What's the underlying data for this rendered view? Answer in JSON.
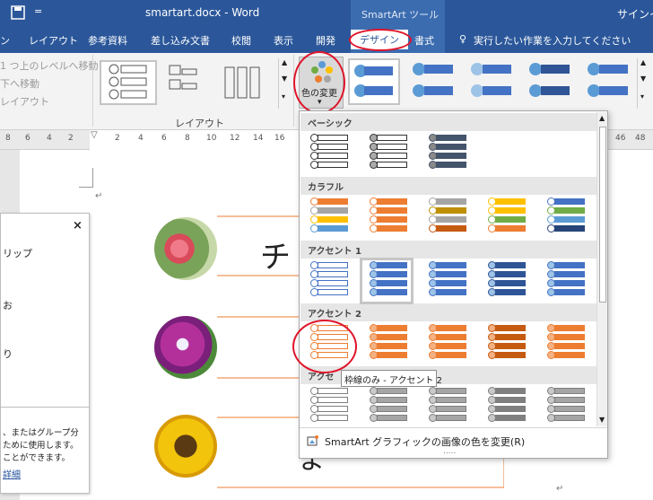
{
  "title_bar": {
    "quick_access_icon": "save-icon",
    "document_title": "smartart.docx  -  Word",
    "context_group": "SmartArt ツール",
    "sign_in": "サインイン"
  },
  "tabs": {
    "items": [
      "ン",
      "レイアウト",
      "参考資料",
      "差し込み文書",
      "校閲",
      "表示",
      "開発"
    ],
    "active": "デザイン",
    "format": "書式",
    "tell_me": "実行したい作業を入力してください"
  },
  "ribbon": {
    "promote": "1 つ上のレベルへ移動",
    "move_down": "下へ移動",
    "layout_btn": "レイアウト",
    "layouts_group_label": "レイアウト",
    "change_colors": "色の変更",
    "change_colors_caret": "▾"
  },
  "ruler": {
    "left_ticks": [
      "8",
      "6",
      "4",
      "2"
    ],
    "right_ticks": [
      "2",
      "4",
      "6",
      "8",
      "10",
      "12",
      "14",
      "16"
    ],
    "far_ticks": [
      "46",
      "48"
    ]
  },
  "pane": {
    "close": "×",
    "items": [
      "リップ",
      "お",
      "り"
    ],
    "desc_lines": [
      "、またはグループ分",
      "ために使用します。",
      "ことができます。"
    ],
    "more": "詳細"
  },
  "document": {
    "chip_text": "チ",
    "bottom_text": "ま",
    "return_mark": "↵"
  },
  "gallery": {
    "sections": [
      {
        "title": "ベーシック",
        "swatches": [
          {
            "dot": "#ffffff",
            "bar": "#ffffff",
            "outline": "#333333"
          },
          {
            "dot": "#aaaaaa",
            "bar": "#ffffff",
            "outline": "#333333"
          },
          {
            "dot": "#8a8a8a",
            "bar": "#44546a",
            "outline": "#44546a"
          }
        ]
      },
      {
        "title": "カラフル",
        "swatches": [
          {
            "colors": [
              "#ed7d31",
              "#a5a5a5",
              "#ffc000",
              "#5b9bd5"
            ]
          },
          {
            "colors": [
              "#ed7d31",
              "#ed7d31",
              "#ed7d31",
              "#ed7d31"
            ]
          },
          {
            "colors": [
              "#a5a5a5",
              "#bf9000",
              "#a5a5a5",
              "#c55a11"
            ]
          },
          {
            "colors": [
              "#ffc000",
              "#ffc000",
              "#70ad47",
              "#ed7d31"
            ]
          },
          {
            "colors": [
              "#4472c4",
              "#70ad47",
              "#5b9bd5",
              "#264478"
            ]
          }
        ]
      },
      {
        "title": "アクセント 1",
        "swatches": [
          {
            "dot": "#ffffff",
            "bar": "#ffffff",
            "outline": "#4472c4"
          },
          {
            "dot": "#9dc3e6",
            "bar": "#4472c4",
            "outline": "#4472c4"
          },
          {
            "dot": "#9dc3e6",
            "bar": "#4472c4",
            "outline": "#4472c4"
          },
          {
            "dot": "#9dc3e6",
            "bar": "#2f5597",
            "outline": "#2f5597"
          },
          {
            "dot": "#9dc3e6",
            "bar": "#4472c4",
            "outline": "#4472c4"
          }
        ]
      },
      {
        "title": "アクセント 2",
        "swatches": [
          {
            "dot": "#ffffff",
            "bar": "#ffffff",
            "outline": "#ed7d31"
          },
          {
            "dot": "#f4b183",
            "bar": "#ed7d31",
            "outline": "#ed7d31"
          },
          {
            "dot": "#f4b183",
            "bar": "#ed7d31",
            "outline": "#ed7d31"
          },
          {
            "dot": "#f4b183",
            "bar": "#c55a11",
            "outline": "#c55a11"
          },
          {
            "dot": "#f4b183",
            "bar": "#ed7d31",
            "outline": "#ed7d31"
          }
        ]
      },
      {
        "title": "アクセ",
        "swatches": [
          {
            "dot": "#ffffff",
            "bar": "#ffffff",
            "outline": "#7f7f7f"
          },
          {
            "dot": "#c9c9c9",
            "bar": "#a5a5a5",
            "outline": "#7f7f7f"
          },
          {
            "dot": "#c9c9c9",
            "bar": "#a5a5a5",
            "outline": "#7f7f7f"
          },
          {
            "dot": "#c9c9c9",
            "bar": "#7f7f7f",
            "outline": "#7f7f7f"
          },
          {
            "dot": "#c9c9c9",
            "bar": "#a5a5a5",
            "outline": "#7f7f7f"
          }
        ]
      }
    ],
    "tooltip": "枠線のみ - アクセント 2",
    "footer": "SmartArt グラフィックの画像の色を変更(R)",
    "footer_icon": "recolor-image-icon",
    "gripper": "....."
  }
}
